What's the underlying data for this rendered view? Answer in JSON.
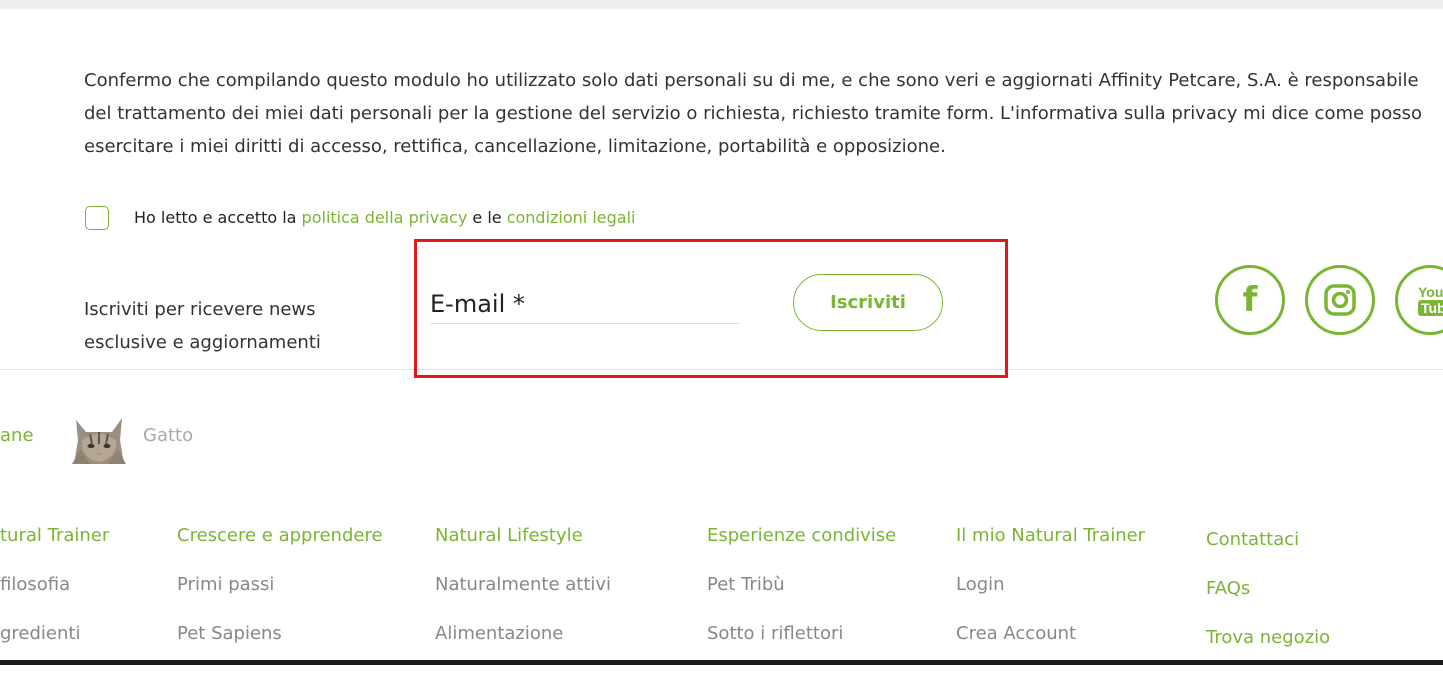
{
  "consent": {
    "text": "Confermo che compilando questo modulo ho utilizzato solo dati personali su di me, e che sono veri e aggiornati Affinity Petcare, S.A. è responsabile del trattamento dei miei dati personali per la gestione del servizio o richiesta, richiesto tramite form. L'informativa sulla privacy mi dice come posso esercitare i miei diritti di accesso, rettifica, cancellazione, limitazione, portabilità e opposizione."
  },
  "accept": {
    "prefix": "Ho letto e accetto la ",
    "privacy_link": "politica della privacy",
    "middle": " e le ",
    "legal_link": "condizioni legali"
  },
  "newsletter": {
    "text": "Iscriviti per ricevere news esclusive e aggiornamenti",
    "email_placeholder": "E-mail *",
    "button": "Iscriviti"
  },
  "social": {
    "facebook": "f",
    "youtube_top": "You",
    "youtube_bottom": "Tube"
  },
  "pets": {
    "dog": "ane",
    "cat": "Gatto"
  },
  "footer": {
    "col1": {
      "head": "tural Trainer",
      "items": [
        "filosofia",
        "gredienti"
      ]
    },
    "col2": {
      "head": "Crescere e apprendere",
      "items": [
        "Primi passi",
        "Pet Sapiens"
      ]
    },
    "col3": {
      "head": "Natural Lifestyle",
      "items": [
        "Naturalmente attivi",
        "Alimentazione"
      ]
    },
    "col4": {
      "head": "Esperienze condivise",
      "items": [
        "Pet Tribù",
        "Sotto i riflettori"
      ]
    },
    "col5": {
      "head": "Il mio Natural Trainer",
      "items": [
        "Login",
        "Crea Account"
      ]
    },
    "col6": {
      "items": [
        "Contattaci",
        "FAQs",
        "Trova negozio"
      ]
    }
  },
  "colors": {
    "accent": "#7ab534",
    "highlight": "#e8141b"
  }
}
